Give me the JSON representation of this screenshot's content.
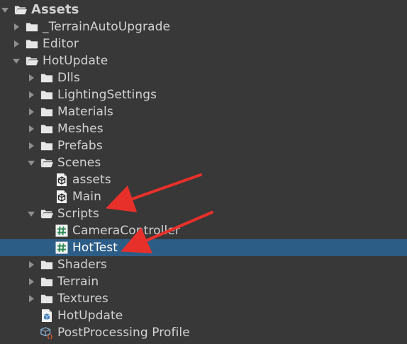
{
  "project_tree": {
    "root": {
      "label": "Assets",
      "expanded": true
    },
    "items": [
      {
        "label": "_TerrainAutoUpgrade",
        "kind": "folder",
        "expanded": false
      },
      {
        "label": "Editor",
        "kind": "folder",
        "expanded": false
      },
      {
        "label": "HotUpdate",
        "kind": "folder",
        "expanded": true
      },
      {
        "label": "Dlls",
        "kind": "folder",
        "expanded": false
      },
      {
        "label": "LightingSettings",
        "kind": "folder",
        "expanded": false
      },
      {
        "label": "Materials",
        "kind": "folder",
        "expanded": false
      },
      {
        "label": "Meshes",
        "kind": "folder",
        "expanded": false
      },
      {
        "label": "Prefabs",
        "kind": "folder",
        "expanded": false
      },
      {
        "label": "Scenes",
        "kind": "folder",
        "expanded": true
      },
      {
        "label": "assets",
        "kind": "scene"
      },
      {
        "label": "Main",
        "kind": "scene"
      },
      {
        "label": "Scripts",
        "kind": "folder",
        "expanded": true
      },
      {
        "label": "CameraController",
        "kind": "script"
      },
      {
        "label": "HotTest",
        "kind": "script",
        "selected": true
      },
      {
        "label": "Shaders",
        "kind": "folder",
        "expanded": false
      },
      {
        "label": "Terrain",
        "kind": "folder",
        "expanded": false
      },
      {
        "label": "Textures",
        "kind": "folder",
        "expanded": false
      },
      {
        "label": "HotUpdate",
        "kind": "assembly-definition"
      },
      {
        "label": "PostProcessing Profile",
        "kind": "postprocessing-profile"
      }
    ]
  },
  "colors": {
    "background": "#383838",
    "selection": "#2c5d87",
    "text": "#d2d2d2",
    "annotation_arrow": "#e8302a"
  },
  "icons": {
    "folder": "folder-icon",
    "open_folder": "folder-open-icon",
    "scene": "unity-scene-icon",
    "script": "csharp-script-icon",
    "assembly": "assembly-definition-icon",
    "profile": "postprocessing-profile-icon"
  }
}
